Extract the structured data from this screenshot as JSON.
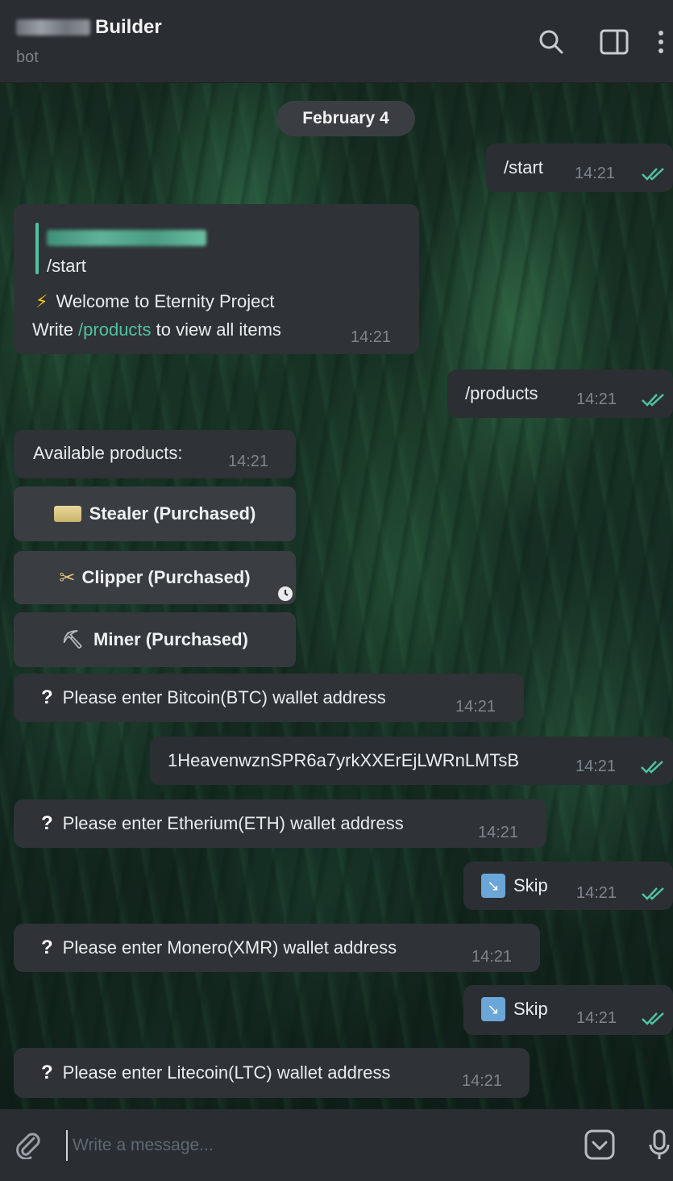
{
  "header": {
    "title": "Builder",
    "subtitle": "bot",
    "icons": [
      "search-icon",
      "sidebar-toggle-icon",
      "more-vertical-icon"
    ]
  },
  "chat": {
    "date_label": "February 4",
    "messages": [
      {
        "dir": "out",
        "text": "/start",
        "time": "14:21"
      },
      {
        "dir": "in",
        "quote_text": "/start",
        "line1": "Welcome to Eternity Project",
        "line2_prefix": "Write ",
        "line2_link": "/products",
        "line2_suffix": " to view all items",
        "time": "14:21"
      },
      {
        "dir": "out",
        "text": "/products",
        "time": "14:21"
      },
      {
        "dir": "in",
        "text": "Available products:",
        "time": "14:21"
      },
      {
        "dir": "in",
        "text": "Please enter Bitcoin(BTC) wallet address",
        "time": "14:21"
      },
      {
        "dir": "out",
        "text": "1HeavenwznSPR6a7yrkXXErEjLWRnLMTsB",
        "time": "14:21"
      },
      {
        "dir": "in",
        "text": "Please enter Etherium(ETH) wallet address",
        "time": "14:21"
      },
      {
        "dir": "out",
        "text": "Skip",
        "time": "14:21"
      },
      {
        "dir": "in",
        "text": "Please enter Monero(XMR) wallet address",
        "time": "14:21"
      },
      {
        "dir": "out",
        "text": "Skip",
        "time": "14:21"
      },
      {
        "dir": "in",
        "text": "Please enter Litecoin(LTC) wallet address",
        "time": "14:21"
      }
    ],
    "buttons": [
      {
        "label": "Stealer (Purchased)",
        "icon": "card-icon"
      },
      {
        "label": "Clipper (Purchased)",
        "icon": "clipper-icon"
      },
      {
        "label": "Miner (Purchased)",
        "icon": "pickaxe-icon"
      }
    ]
  },
  "footer": {
    "placeholder": "Write a message...",
    "icons": [
      "attach-icon",
      "emoji-icon",
      "mic-icon"
    ]
  },
  "colors": {
    "accent": "#4fc3a1",
    "bubble": "#2f3236",
    "header": "#2a2d31"
  }
}
